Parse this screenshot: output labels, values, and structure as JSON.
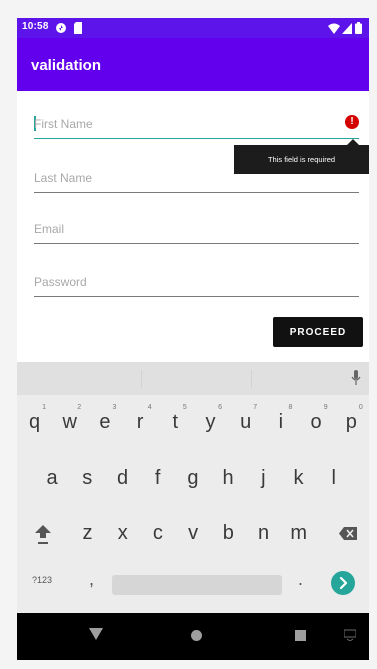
{
  "status_bar": {
    "time": "10:58",
    "icons": [
      "sync-icon",
      "sd-card-icon",
      "wifi-icon",
      "cellular-icon",
      "battery-icon"
    ]
  },
  "app_bar": {
    "title": "validation",
    "color": "#6200ee"
  },
  "form": {
    "first_name": {
      "value": "",
      "placeholder": "First Name",
      "error": "This field is required"
    },
    "last_name": {
      "value": "",
      "placeholder": "Last Name"
    },
    "email": {
      "value": "",
      "placeholder": "Email"
    },
    "password": {
      "value": "",
      "placeholder": "Password"
    },
    "proceed_label": "PROCEED",
    "accent_color": "#26a69a",
    "error_color": "#d50000"
  },
  "keyboard": {
    "row1": [
      {
        "key": "q",
        "hint": "1"
      },
      {
        "key": "w",
        "hint": "2"
      },
      {
        "key": "e",
        "hint": "3"
      },
      {
        "key": "r",
        "hint": "4"
      },
      {
        "key": "t",
        "hint": "5"
      },
      {
        "key": "y",
        "hint": "6"
      },
      {
        "key": "u",
        "hint": "7"
      },
      {
        "key": "i",
        "hint": "8"
      },
      {
        "key": "o",
        "hint": "9"
      },
      {
        "key": "p",
        "hint": "0"
      }
    ],
    "row2": [
      "a",
      "s",
      "d",
      "f",
      "g",
      "h",
      "j",
      "k",
      "l"
    ],
    "row3": [
      "z",
      "x",
      "c",
      "v",
      "b",
      "n",
      "m"
    ],
    "symbols_label": "?123",
    "comma": ",",
    "period": "."
  },
  "nav_bar": {
    "buttons": [
      "back-icon",
      "home-icon",
      "recents-icon",
      "keyboard-switch-icon"
    ]
  }
}
